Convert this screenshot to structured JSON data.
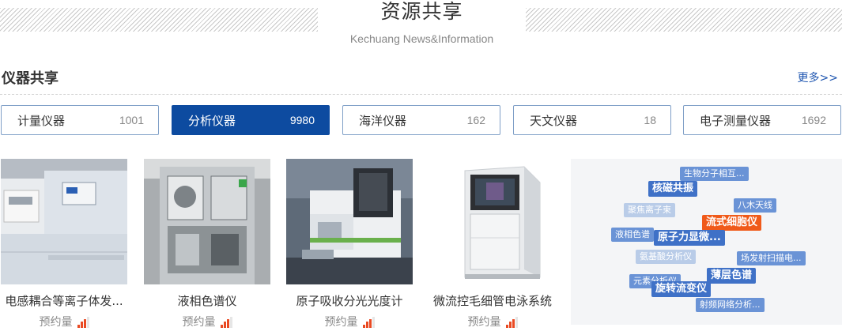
{
  "section": {
    "title": "资源共享",
    "subtitle": "Kechuang News&Information"
  },
  "category": {
    "title": "仪器共享",
    "more_label": "更多>>"
  },
  "tabs": [
    {
      "label": "计量仪器",
      "count": "1001",
      "active": false
    },
    {
      "label": "分析仪器",
      "count": "9980",
      "active": true
    },
    {
      "label": "海洋仪器",
      "count": "162",
      "active": false
    },
    {
      "label": "天文仪器",
      "count": "18",
      "active": false
    },
    {
      "label": "电子测量仪器",
      "count": "1692",
      "active": false
    }
  ],
  "cards": [
    {
      "name": "电感耦合等离子体发...",
      "appointment_label": "预约量",
      "image": "icp-instrument-photo"
    },
    {
      "name": "液相色谱仪",
      "appointment_label": "预约量",
      "image": "liquid-chromatograph-photo"
    },
    {
      "name": "原子吸收分光光度计",
      "appointment_label": "预约量",
      "image": "atomic-absorption-photo"
    },
    {
      "name": "微流控毛细管电泳系统",
      "appointment_label": "预约量",
      "image": "capillary-electrophoresis-photo"
    }
  ],
  "tag_cloud": [
    {
      "label": "生物分子相互...",
      "style": "normal"
    },
    {
      "label": "核磁共振",
      "style": "big"
    },
    {
      "label": "八木天线",
      "style": "normal"
    },
    {
      "label": "聚焦离子束",
      "style": "faint"
    },
    {
      "label": "流式细胞仪",
      "style": "hot"
    },
    {
      "label": "液相色谱",
      "style": "normal"
    },
    {
      "label": "原子力显微...",
      "style": "big"
    },
    {
      "label": "氨基酸分析仪",
      "style": "faint"
    },
    {
      "label": "场发射扫描电...",
      "style": "normal"
    },
    {
      "label": "薄层色谱",
      "style": "big"
    },
    {
      "label": "元素分析仪",
      "style": "normal"
    },
    {
      "label": "旋转流变仪",
      "style": "big"
    },
    {
      "label": "射频网络分析...",
      "style": "normal"
    }
  ],
  "colors": {
    "accent": "#0d4ba0",
    "link": "#1f56b0",
    "hot": "#f05a1a",
    "signal": "#e94a23"
  }
}
